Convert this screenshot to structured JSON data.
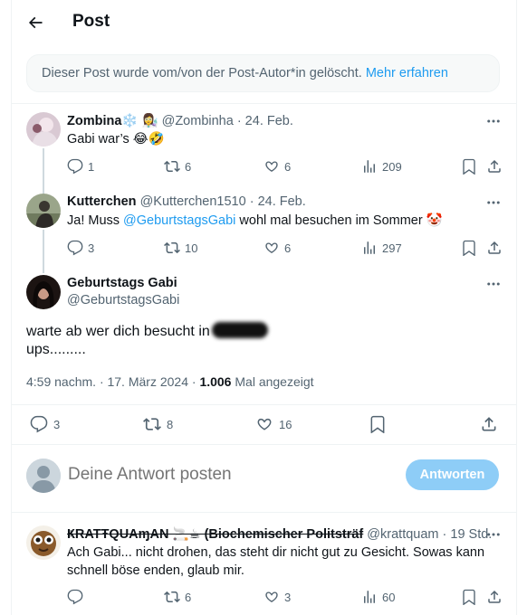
{
  "header": {
    "title": "Post"
  },
  "deleted_notice": {
    "text": "Dieser Post wurde vom/von der Post-Autor*in gelöscht.",
    "link": "Mehr erfahren"
  },
  "replies_above": [
    {
      "name": "Zombina❄️ 👩‍🔬",
      "handle": "@Zombinha",
      "date": "· 24. Feb.",
      "text": "Gabi war’s 😂🤣",
      "stats": {
        "replies": "1",
        "reposts": "6",
        "likes": "6",
        "views": "209"
      }
    },
    {
      "name": "Kutterchen",
      "handle": "@Kutterchen1510",
      "date": "· 24. Feb.",
      "text_before": "Ja! Muss ",
      "mention": "@GeburtstagsGabi",
      "text_after": " wohl mal besuchen im Sommer 🤡",
      "stats": {
        "replies": "3",
        "reposts": "10",
        "likes": "6",
        "views": "297"
      }
    }
  ],
  "main_post": {
    "name": "Geburtstags Gabi",
    "handle": "@GeburtstagsGabi",
    "line1": "warte ab wer dich besucht in",
    "line2": "ups.........",
    "time": "4:59 nachm. · 17. März 2024 ·",
    "views_count": "1.006",
    "views_label": "Mal angezeigt",
    "stats": {
      "replies": "3",
      "reposts": "8",
      "likes": "16"
    }
  },
  "composer": {
    "placeholder": "Deine Antwort posten",
    "button": "Antworten"
  },
  "reply_below": {
    "name": "ҜRATŦQUAɱAN 🚬☕ (Biochemischer Politsträf",
    "handle": "@krattquam",
    "date": "· 19 Std.",
    "text": "Ach Gabi... nicht drohen, das steht dir nicht gut zu Gesicht. Sowas kann schnell böse enden, glaub mir.",
    "stats": {
      "replies": "",
      "reposts": "6",
      "likes": "3",
      "views": "60"
    }
  },
  "colors": {
    "accent": "#1d9bf0",
    "muted": "#536471",
    "text": "#0f1419",
    "border": "#eff3f4"
  }
}
